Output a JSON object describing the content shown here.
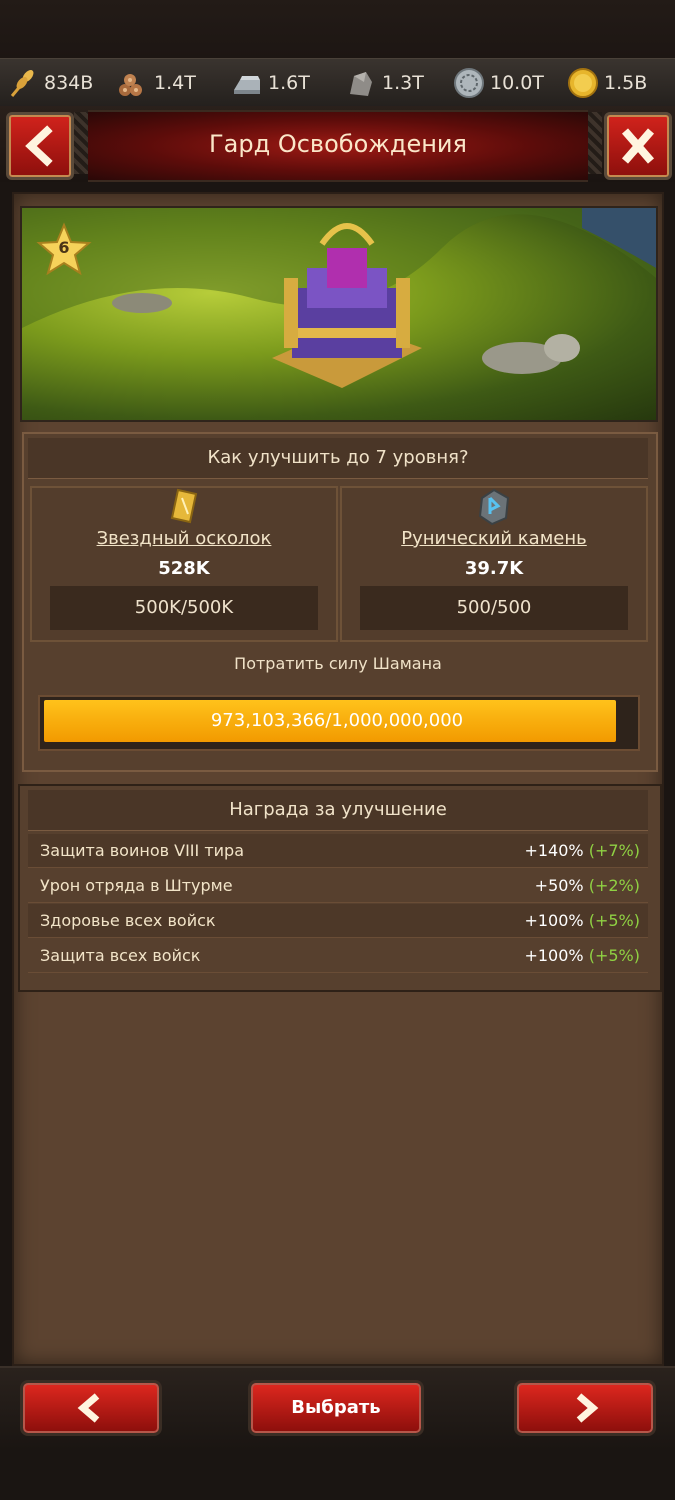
{
  "resources": [
    {
      "icon": "wheat-icon",
      "value": "834B"
    },
    {
      "icon": "wood-logs-icon",
      "value": "1.4T"
    },
    {
      "icon": "iron-ingot-icon",
      "value": "1.6T"
    },
    {
      "icon": "stone-icon",
      "value": "1.3T"
    },
    {
      "icon": "silver-coin-icon",
      "value": "10.0T"
    },
    {
      "icon": "gold-coin-icon",
      "value": "1.5B"
    }
  ],
  "header": {
    "title": "Гард Освобождения"
  },
  "hero": {
    "level": "6"
  },
  "upgrade": {
    "title": "Как улучшить до 7 уровня?",
    "items": [
      {
        "icon": "star-shard-icon",
        "name": "Звездный осколок",
        "amount": "528K",
        "progress": "500K/500K"
      },
      {
        "icon": "rune-stone-icon",
        "name": "Рунический камень",
        "amount": "39.7K",
        "progress": "500/500"
      }
    ],
    "spend_label": "Потратить силу Шамана",
    "power_progress": "973,103,366/1,000,000,000",
    "power_fraction": 0.973
  },
  "reward": {
    "title": "Награда за улучшение",
    "rows": [
      {
        "label": "Защита воинов VIII тира",
        "value": "+140%",
        "bonus": "(+7%)"
      },
      {
        "label": "Урон отряда в Штурме",
        "value": "+50%",
        "bonus": "(+2%)"
      },
      {
        "label": "Здоровье всех войск",
        "value": "+100%",
        "bonus": "(+5%)"
      },
      {
        "label": "Защита всех войск",
        "value": "+100%",
        "bonus": "(+5%)"
      }
    ]
  },
  "footer": {
    "select_label": "Выбрать"
  },
  "colors": {
    "accent_red": "#c8201a",
    "progress_gold": "#f7a800",
    "bonus_green": "#8fd143"
  }
}
